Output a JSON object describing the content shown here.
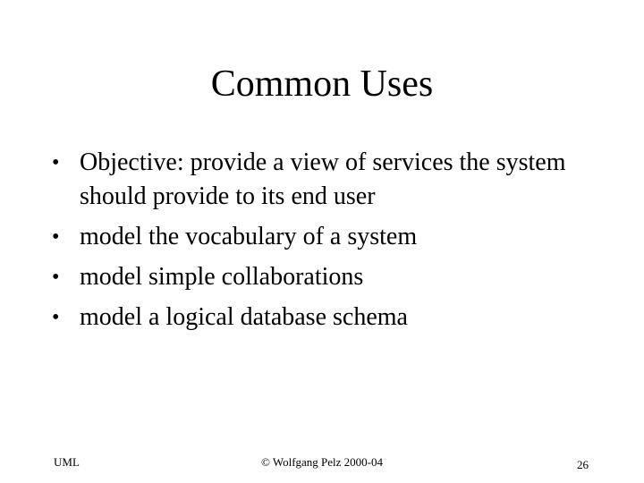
{
  "slide": {
    "title": "Common Uses",
    "bullet_glyph": "•",
    "bullets": [
      "Objective: provide a view of services the system should provide to its end user",
      "model the vocabulary of a system",
      "model simple collaborations",
      "model a logical database schema"
    ]
  },
  "footer": {
    "left": "UML",
    "center": "© Wolfgang Pelz 2000-04",
    "page_number": "26"
  }
}
